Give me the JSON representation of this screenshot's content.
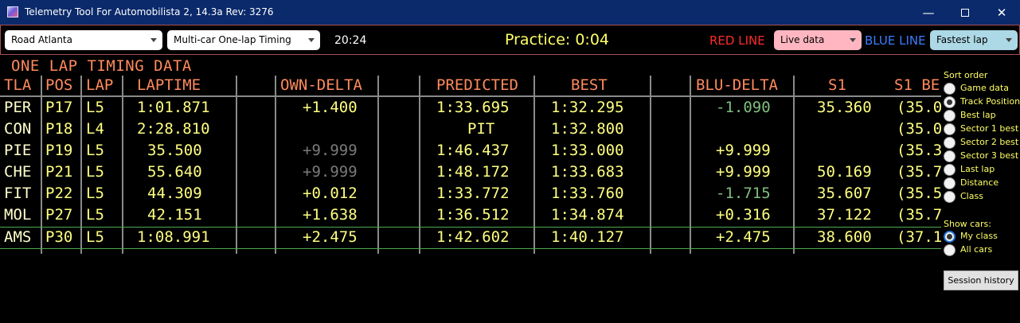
{
  "window": {
    "title": "Telemetry Tool For Automobilista 2, 14.3a Rev: 3276",
    "minimize": "—",
    "close": "✕"
  },
  "toolbar": {
    "track": "Road Atlanta",
    "mode": "Multi-car  One-lap Timing",
    "clock": "20:24",
    "session": "Practice: 0:04",
    "red_line_label": "RED LINE",
    "red_line_value": "Live data",
    "blue_line_label": "BLUE LINE",
    "blue_line_value": "Fastest lap"
  },
  "timing": {
    "heading": "ONE LAP TIMING DATA",
    "headers": {
      "tla": "TLA",
      "pos": "POS",
      "lap": "LAP",
      "laptime": "LAPTIME",
      "own_delta": "OWN-DELTA",
      "predicted": "PREDICTED",
      "best": "BEST",
      "blu_delta": "BLU-DELTA",
      "s1": "S1",
      "s1best": "S1 BE"
    },
    "rows": [
      {
        "tla": "PER",
        "pos": "P17",
        "lap": "L5",
        "laptime": "1:01.871",
        "own_delta": "+1.400",
        "predicted": "1:33.695",
        "best": "1:32.295",
        "blu_delta": "-1.090",
        "s1": "35.360",
        "s1best": "(35.0"
      },
      {
        "tla": "CON",
        "pos": "P18",
        "lap": "L4",
        "laptime": "2:28.810",
        "own_delta": "",
        "predicted": "PIT",
        "best": "1:32.800",
        "blu_delta": "",
        "s1": "",
        "s1best": "(35.0"
      },
      {
        "tla": "PIE",
        "pos": "P19",
        "lap": "L5",
        "laptime": "35.500",
        "own_delta": "+9.999",
        "predicted": "1:46.437",
        "best": "1:33.000",
        "blu_delta": "+9.999",
        "s1": "",
        "s1best": "(35.3"
      },
      {
        "tla": "CHE",
        "pos": "P21",
        "lap": "L5",
        "laptime": "55.640",
        "own_delta": "+9.999",
        "predicted": "1:48.172",
        "best": "1:33.683",
        "blu_delta": "+9.999",
        "s1": "50.169",
        "s1best": "(35.7"
      },
      {
        "tla": "FIT",
        "pos": "P22",
        "lap": "L5",
        "laptime": "44.309",
        "own_delta": "+0.012",
        "predicted": "1:33.772",
        "best": "1:33.760",
        "blu_delta": "-1.715",
        "s1": "35.607",
        "s1best": "(35.5"
      },
      {
        "tla": "MOL",
        "pos": "P27",
        "lap": "L5",
        "laptime": "42.151",
        "own_delta": "+1.638",
        "predicted": "1:36.512",
        "best": "1:34.874",
        "blu_delta": "+0.316",
        "s1": "37.122",
        "s1best": "(35.7"
      },
      {
        "tla": "AMS",
        "pos": "P30",
        "lap": "L5",
        "laptime": "1:08.991",
        "own_delta": "+2.475",
        "predicted": "1:42.602",
        "best": "1:40.127",
        "blu_delta": "+2.475",
        "s1": "38.600",
        "s1best": "(37.1"
      }
    ]
  },
  "side": {
    "sort_label": "Sort order",
    "sort_options": [
      "Game data",
      "Track Position",
      "Best lap",
      "Sector 1 best",
      "Sector 2 best",
      "Sector 3 best",
      "Last lap",
      "Distance",
      "Class"
    ],
    "sort_selected": "Track Position",
    "show_label": "Show cars:",
    "show_options": [
      "My class",
      "All cars"
    ],
    "show_selected": "My class",
    "history_button": "Session history"
  },
  "colors": {
    "titlebar": "#0b2a6b",
    "header_text": "#ff8a5c",
    "cell_text": "#ffffcc",
    "delta_gray": "#7a7a7a",
    "delta_green": "#7fbf7f",
    "highlight_border": "#4fa84f",
    "red_line": "#ff2a2a",
    "blue_line": "#3b7dff",
    "side_text": "#ffff66"
  }
}
